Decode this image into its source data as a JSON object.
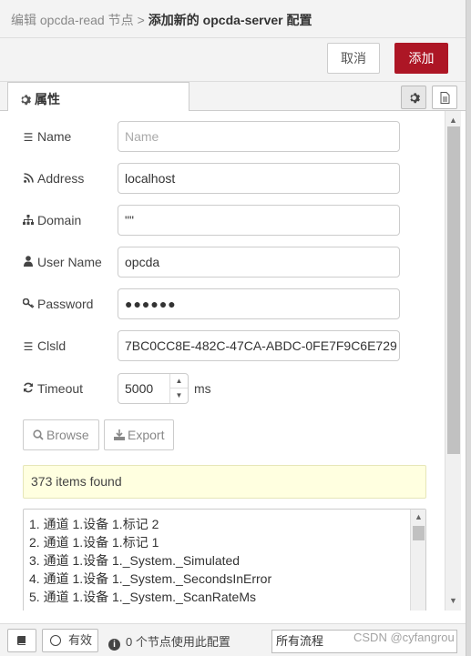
{
  "breadcrumb": {
    "parent": "编辑 opcda-read 节点",
    "separator": ">",
    "current": "添加新的 opcda-server 配置"
  },
  "toolbar": {
    "cancel_label": "取消",
    "add_label": "添加"
  },
  "tabs": {
    "properties_label": "属性"
  },
  "form": {
    "name": {
      "label": "Name",
      "value": "",
      "placeholder": "Name"
    },
    "address": {
      "label": "Address",
      "value": "localhost"
    },
    "domain": {
      "label": "Domain",
      "value": "\"\""
    },
    "username": {
      "label": "User Name",
      "value": "opcda"
    },
    "password": {
      "label": "Password",
      "value": "●●●●●●"
    },
    "clsid": {
      "label": "Clsld",
      "value": "7BC0CC8E-482C-47CA-ABDC-0FE7F9C6E729"
    },
    "timeout": {
      "label": "Timeout",
      "value": "5000",
      "unit": "ms"
    }
  },
  "actions": {
    "browse_label": "Browse",
    "export_label": "Export"
  },
  "results": {
    "found_text": "373 items found",
    "items": [
      "1. 通道 1.设备 1.标记 2",
      "2. 通道 1.设备 1.标记 1",
      "3. 通道 1.设备 1._System._Simulated",
      "4. 通道 1.设备 1._System._SecondsInError",
      "5. 通道 1.设备 1._System._ScanRateMs"
    ]
  },
  "footer": {
    "enabled_label": "有效",
    "usage_text": "0 个节点使用此配置",
    "scope_value": "所有流程"
  },
  "watermark": "CSDN @cyfangrou"
}
